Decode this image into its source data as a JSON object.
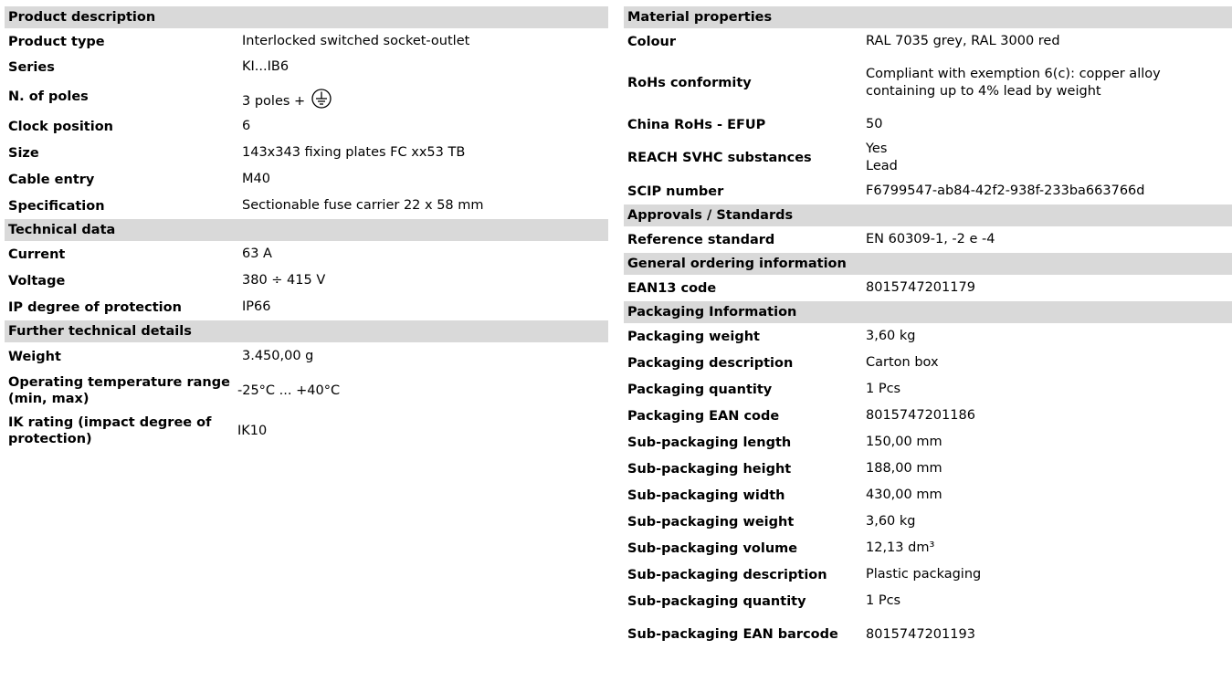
{
  "left": {
    "sections": [
      {
        "title": "Product description",
        "rows": [
          {
            "label": "Product type",
            "value": "Interlocked switched socket-outlet"
          },
          {
            "label": "Series",
            "value": "KI...IB6"
          },
          {
            "label": "N. of poles",
            "value": "3 poles +"
          },
          {
            "label": "Clock position",
            "value": "6"
          },
          {
            "label": "Size",
            "value": "143x343 fixing plates FC xx53 TB"
          },
          {
            "label": "Cable entry",
            "value": "M40"
          },
          {
            "label": "Specification",
            "value": "Sectionable fuse carrier 22 x 58 mm"
          }
        ]
      },
      {
        "title": "Technical data",
        "rows": [
          {
            "label": "Current",
            "value": "63 A"
          },
          {
            "label": "Voltage",
            "value": "380 ÷ 415 V"
          },
          {
            "label": "IP degree of protection",
            "value": "IP66"
          }
        ]
      },
      {
        "title": "Further technical details",
        "rows": [
          {
            "label": "Weight",
            "value": "3.450,00 g"
          },
          {
            "label": "Operating temperature range (min, max)",
            "value": "-25°C ... +40°C"
          },
          {
            "label": "IK rating (impact degree of protection)",
            "value": "IK10"
          }
        ]
      }
    ]
  },
  "right": {
    "sections": [
      {
        "title": "Material properties",
        "rows": [
          {
            "label": "Colour",
            "value": "RAL 7035 grey, RAL 3000 red"
          },
          {
            "label": "RoHs conformity",
            "value": "Compliant with exemption 6(c): copper alloy containing up to 4% lead by weight"
          },
          {
            "label": "China RoHs - EFUP",
            "value": "50"
          },
          {
            "label": "REACH SVHC substances",
            "value": "Yes",
            "value2": "Lead"
          },
          {
            "label": "SCIP number",
            "value": "F6799547-ab84-42f2-938f-233ba663766d"
          }
        ]
      },
      {
        "title": "Approvals / Standards",
        "rows": [
          {
            "label": "Reference standard",
            "value": "EN 60309-1, -2 e -4"
          }
        ]
      },
      {
        "title": "General ordering information",
        "rows": [
          {
            "label": "EAN13 code",
            "value": "8015747201179"
          }
        ]
      },
      {
        "title": "Packaging Information",
        "rows": [
          {
            "label": "Packaging weight",
            "value": "3,60 kg"
          },
          {
            "label": "Packaging description",
            "value": "Carton box"
          },
          {
            "label": "Packaging quantity",
            "value": "1 Pcs"
          },
          {
            "label": "Packaging EAN code",
            "value": "8015747201186"
          },
          {
            "label": "Sub-packaging length",
            "value": "150,00 mm"
          },
          {
            "label": "Sub-packaging height",
            "value": "188,00 mm"
          },
          {
            "label": "Sub-packaging width",
            "value": "430,00 mm"
          },
          {
            "label": "Sub-packaging weight",
            "value": "3,60 kg"
          },
          {
            "label": "Sub-packaging volume",
            "value": "12,13 dm³"
          },
          {
            "label": "Sub-packaging description",
            "value": "Plastic packaging"
          },
          {
            "label": "Sub-packaging quantity",
            "value": "1 Pcs"
          },
          {
            "label": "Sub-packaging EAN barcode",
            "value": "8015747201193"
          }
        ]
      }
    ]
  },
  "icons": {
    "earth": "protective-earth-icon"
  }
}
